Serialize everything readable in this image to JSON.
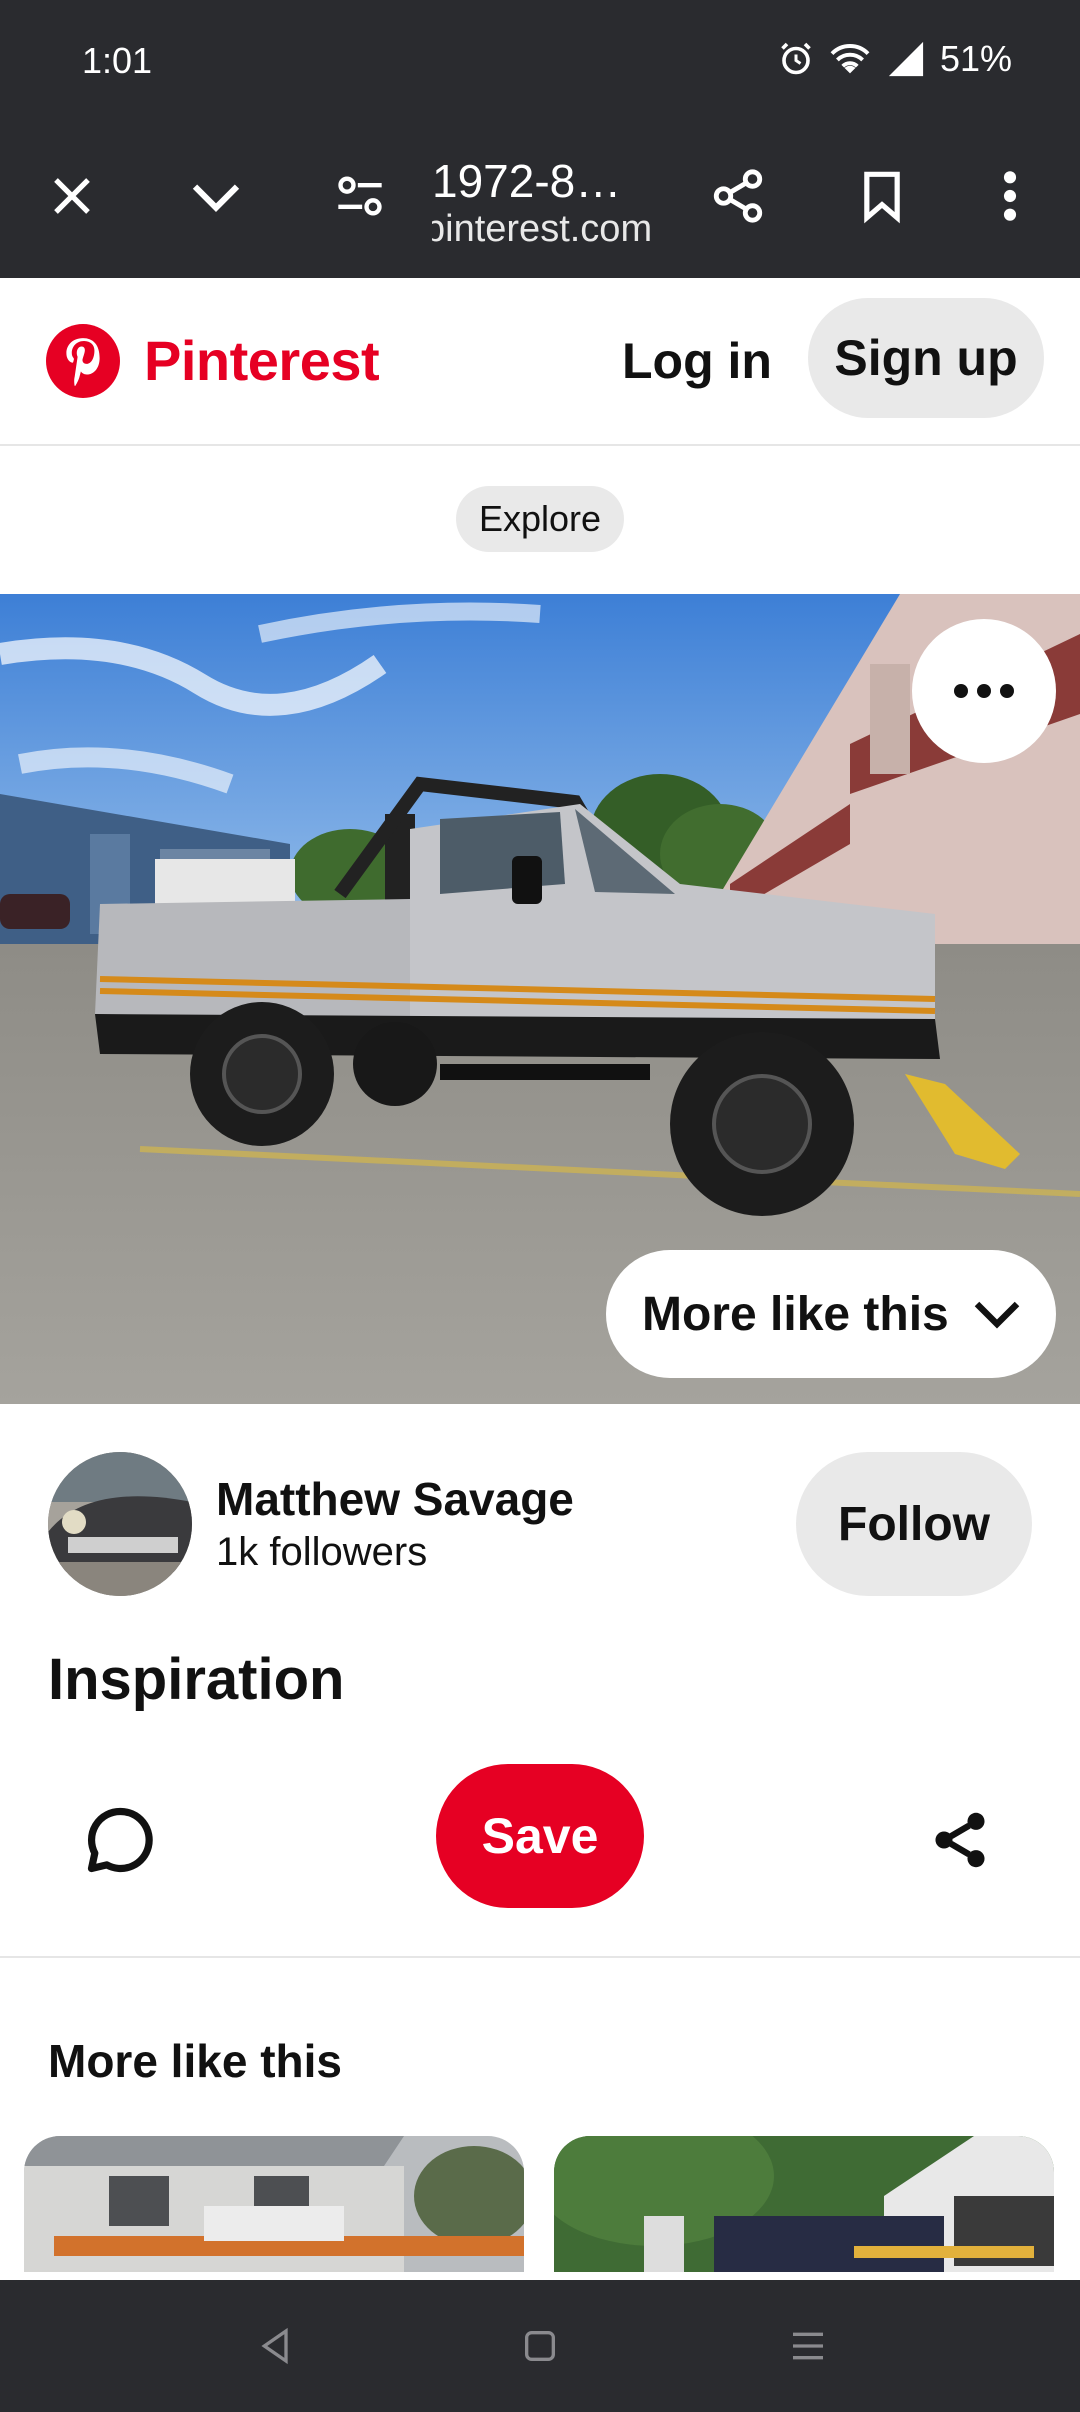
{
  "status_bar": {
    "time": "1:01",
    "battery": "51%"
  },
  "browser": {
    "page_title": "1972-8…",
    "domain": "pinterest.com"
  },
  "header": {
    "brand": "Pinterest",
    "login_label": "Log in",
    "signup_label": "Sign up"
  },
  "explore_label": "Explore",
  "pin": {
    "more_like_this_label": "More like this",
    "creator_name": "Matthew Savage",
    "creator_followers": "1k followers",
    "follow_label": "Follow",
    "title": "Inspiration",
    "save_label": "Save"
  },
  "more_section": {
    "title": "More like this"
  },
  "colors": {
    "brand": "#e60023",
    "chrome": "#2a2b2f",
    "chip": "#e9e9e9"
  }
}
